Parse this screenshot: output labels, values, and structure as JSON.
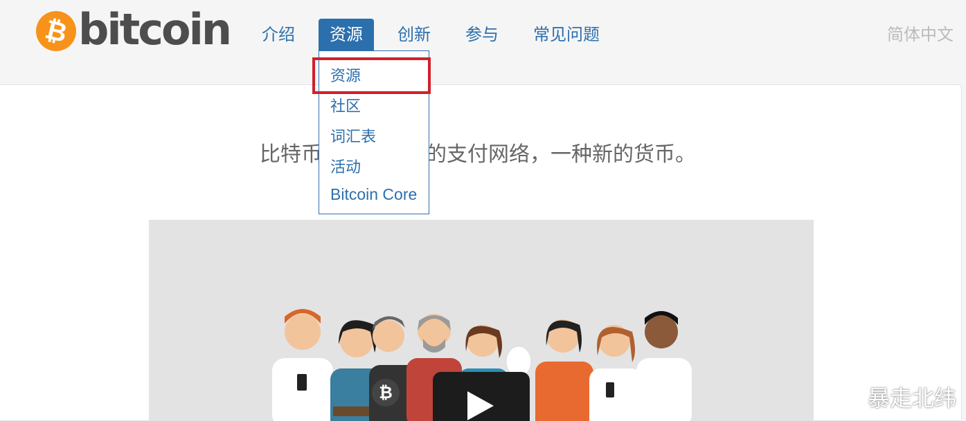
{
  "header": {
    "logo_text": "bitcoin",
    "logo_symbol": "₿",
    "nav": [
      {
        "label": "介绍"
      },
      {
        "label": "资源"
      },
      {
        "label": "创新"
      },
      {
        "label": "参与"
      },
      {
        "label": "常见问题"
      }
    ],
    "language": "简体中文"
  },
  "dropdown": {
    "items": [
      {
        "label": "资源"
      },
      {
        "label": "社区"
      },
      {
        "label": "词汇表"
      },
      {
        "label": "活动"
      },
      {
        "label": "Bitcoin Core"
      }
    ]
  },
  "main": {
    "headline": "比特币是一种创新的支付网络，一种新的货币。"
  },
  "watermark": {
    "text": "暴走北纬",
    "icon": "weibo-icon"
  },
  "colors": {
    "accent": "#2c6fad",
    "brand_orange": "#f7931a",
    "highlight_red": "#d0202a"
  }
}
